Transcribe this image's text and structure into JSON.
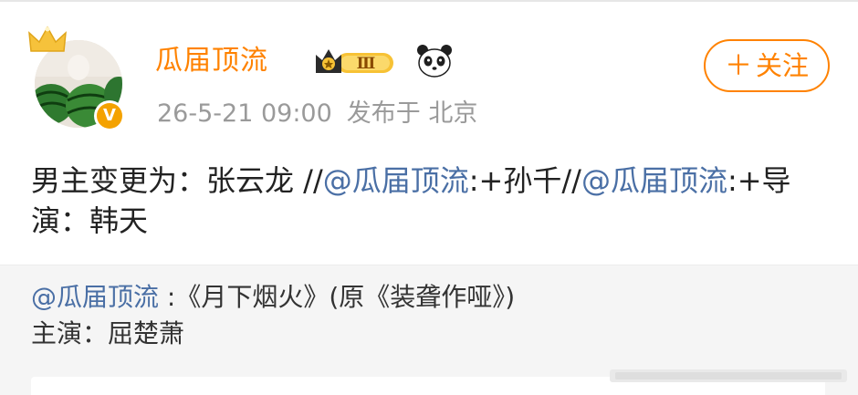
{
  "post": {
    "username": "瓜届顶流",
    "level": "Ⅲ",
    "verified_mark": "V",
    "timestamp": "26-5-21 09:00",
    "location_text": "发布于 北京",
    "follow_label": "关注",
    "follow_plus": "＋",
    "text_before": "男主变更为：张云龙 //",
    "mention_1": "@瓜届顶流",
    "text_mid1": ":+孙千//",
    "mention_2": "@瓜届顶流",
    "text_mid2": ":+导演：韩天"
  },
  "repost": {
    "mention": "@瓜届顶流",
    "line1_text": " :《月下烟火》(原《装聋作哑》)",
    "line2_text": "主演：屈楚萧"
  },
  "colors": {
    "accent": "#ff8200",
    "mention": "#4a6fa5",
    "meta": "#9a9a9a",
    "repost_bg": "#f5f5f5"
  },
  "icons": {
    "crown": "crown-icon",
    "level_badge": "level-badge-icon",
    "panda": "panda-icon",
    "verified": "verified-icon"
  }
}
